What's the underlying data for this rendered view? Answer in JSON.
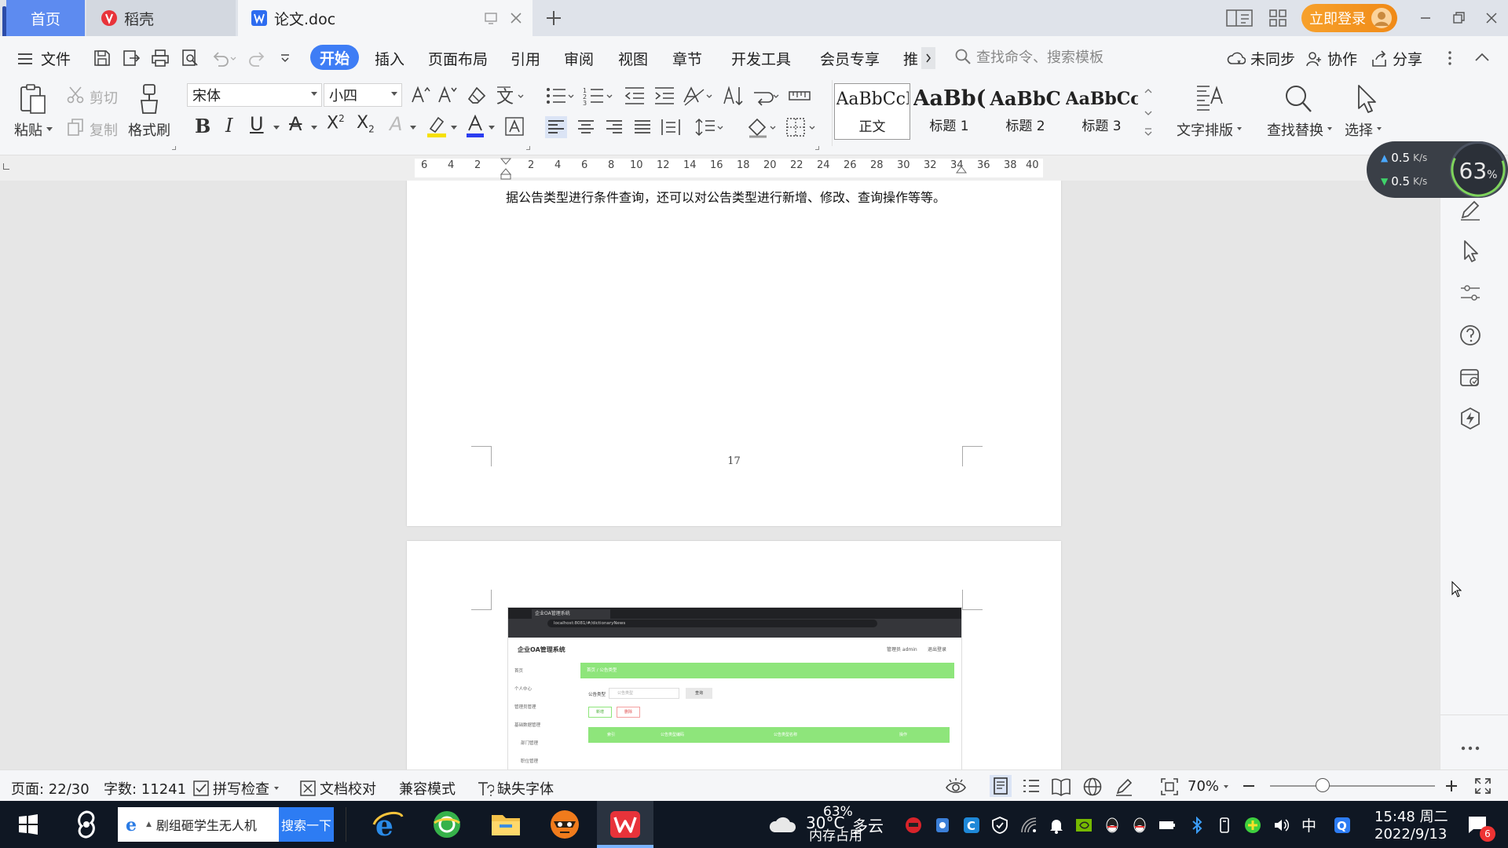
{
  "titlebar": {
    "tabs": [
      {
        "label": "首页"
      },
      {
        "label": "稻壳"
      },
      {
        "label": "论文.doc"
      }
    ],
    "login_label": "立即登录"
  },
  "menubar": {
    "items": [
      "文件",
      "开始",
      "插入",
      "页面布局",
      "引用",
      "审阅",
      "视图",
      "章节",
      "开发工具",
      "会员专享",
      "推"
    ],
    "search_placeholder": "查找命令、搜索模板",
    "sync": "未同步",
    "collab": "协作",
    "share": "分享"
  },
  "ribbon": {
    "paste": "粘贴",
    "cut": "剪切",
    "copy": "复制",
    "format_painter": "格式刷",
    "font_name": "宋体",
    "font_size": "小四",
    "styles": [
      {
        "preview": "AaBbCcI",
        "name": "正文"
      },
      {
        "preview": "AaBb(",
        "name": "标题 1"
      },
      {
        "preview": "AaBbC",
        "name": "标题 2"
      },
      {
        "preview": "AaBbCcl",
        "name": "标题 3"
      }
    ],
    "text_layout": "文字排版",
    "find_replace": "查找替换",
    "select": "选择"
  },
  "ruler": {
    "numbers": [
      "6",
      "4",
      "2",
      "2",
      "4",
      "6",
      "8",
      "10",
      "12",
      "14",
      "16",
      "18",
      "20",
      "22",
      "24",
      "26",
      "28",
      "30",
      "32",
      "34",
      "36",
      "38",
      "40"
    ]
  },
  "document": {
    "top_line": "据公告类型进行条件查询，还可以对公告类型进行新增、修改、查询操作等等。",
    "page_number": "17",
    "screenshot": {
      "tab_title": "企业OA管理系统",
      "url": "localhost:8081/#/dictionaryNews",
      "app_title": "企业OA管理系统",
      "user_info": "管理员 admin",
      "logout": "退出登录",
      "nav": [
        "首页",
        "个人中心",
        "管理员管理",
        "基础数据管理",
        "部门管理",
        "职位管理"
      ],
      "breadcrumb": "首页 / 公告类型",
      "filter_label": "公告类型",
      "filter_placeholder": "公告类型",
      "query_btn": "查询",
      "add_btn": "新增",
      "delete_btn": "删除",
      "columns": [
        "索引",
        "公告类型编码",
        "公告类型名称",
        "操作"
      ]
    }
  },
  "speed_widget": {
    "up": "0.5",
    "down": "0.5",
    "unit": "K/s",
    "percent": "63"
  },
  "statusbar": {
    "page": "页面: 22/30",
    "words": "字数: 11241",
    "spell": "拼写检查",
    "proof": "文档校对",
    "compat": "兼容模式",
    "missing_font": "缺失字体",
    "zoom": "70%"
  },
  "taskbar": {
    "search_text": "剧组砸学生无人机",
    "search_button": "搜索一下",
    "weather_temp": "30°C",
    "weather_desc": "多云",
    "mem_percent": "63%",
    "mem_label": "内存占用",
    "ime": "中",
    "time": "15:48 周二",
    "date": "2022/9/13",
    "notif_count": "6"
  },
  "colors": {
    "accent": "#3e7df5",
    "login": "#f08a17",
    "green": "#8ee57b",
    "taskbar": "#0f1723"
  }
}
